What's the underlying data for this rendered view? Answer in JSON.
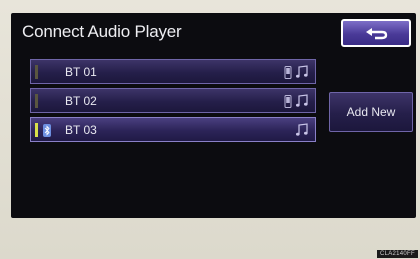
{
  "screen": {
    "title": "Connect Audio Player"
  },
  "back_button": {
    "icon": "return-arrow-icon"
  },
  "devices": [
    {
      "name": "BT 01",
      "connected": false,
      "has_phone": true,
      "has_audio": true
    },
    {
      "name": "BT 02",
      "connected": false,
      "has_phone": true,
      "has_audio": true
    },
    {
      "name": "BT 03",
      "connected": true,
      "has_phone": false,
      "has_audio": true
    }
  ],
  "add_new": {
    "label": "Add New"
  },
  "colors": {
    "accent": "#4a3a98",
    "connected_indicator": "#d8e04a"
  },
  "figure_code": "CLA2140FF"
}
